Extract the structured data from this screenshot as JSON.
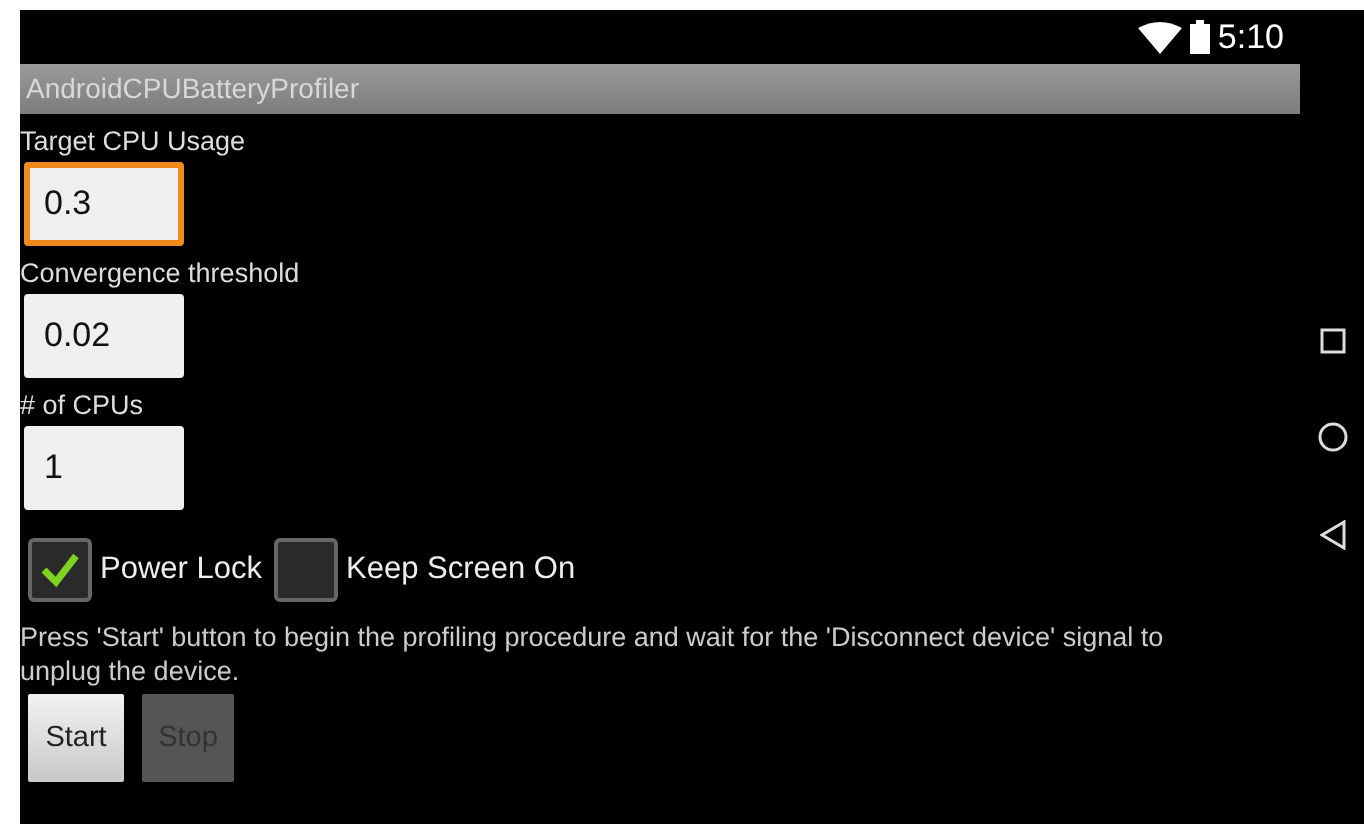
{
  "status_bar": {
    "time": "5:10"
  },
  "app_bar": {
    "title": "AndroidCPUBatteryProfiler"
  },
  "fields": [
    {
      "label": "Target CPU Usage",
      "value": "0.3",
      "focused": true
    },
    {
      "label": "Convergence threshold",
      "value": "0.02",
      "focused": false
    },
    {
      "label": "# of CPUs",
      "value": "1",
      "focused": false
    }
  ],
  "checkboxes": [
    {
      "label": "Power Lock",
      "checked": true
    },
    {
      "label": "Keep Screen On",
      "checked": false
    }
  ],
  "instructions": "Press 'Start' button to begin the profiling procedure and wait for the 'Disconnect device' signal to unplug the device.",
  "buttons": [
    {
      "label": "Start",
      "disabled": false
    },
    {
      "label": "Stop",
      "disabled": true
    }
  ]
}
